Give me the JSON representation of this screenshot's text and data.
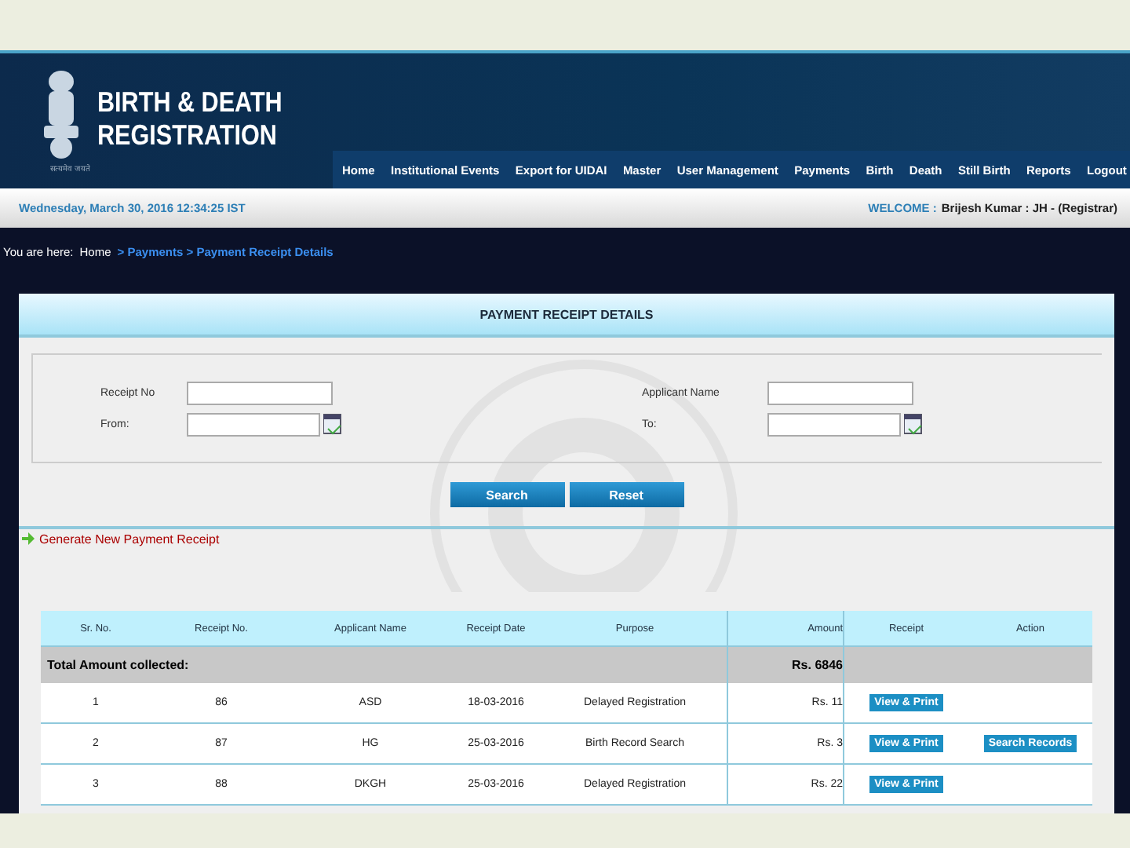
{
  "header": {
    "title_lines": [
      "BIRTH & DEATH",
      "REGISTRATION"
    ],
    "emblem_caption": "सत्यमेव जयते"
  },
  "nav": [
    "Home",
    "Institutional Events",
    "Export for UIDAI",
    "Master",
    "User Management",
    "Payments",
    "Birth",
    "Death",
    "Still Birth",
    "Reports",
    "Logout"
  ],
  "info_bar": {
    "datetime": "Wednesday, March 30, 2016 12:34:25 IST",
    "welcome_label": "WELCOME :",
    "user": "Brijesh Kumar : JH -  (Registrar)"
  },
  "breadcrumb": {
    "prefix": "You are here:",
    "home": "Home",
    "trail": "> Payments > Payment Receipt Details"
  },
  "panel": {
    "title": "PAYMENT RECEIPT DETAILS",
    "fields": [
      {
        "label": "Receipt No",
        "calendar": false
      },
      {
        "label": "Applicant Name",
        "calendar": false
      },
      {
        "label": "From:",
        "calendar": true
      },
      {
        "label": "To:",
        "calendar": true
      }
    ],
    "buttons": [
      "Search",
      "Reset"
    ],
    "generate_link": "Generate New Payment Receipt"
  },
  "table": {
    "columns": [
      "Sr. No.",
      "Receipt No.",
      "Applicant Name",
      "Receipt Date",
      "Purpose",
      "Amount",
      "Receipt",
      "Action"
    ],
    "total": {
      "label": "Total Amount collected:",
      "amount": "Rs. 6846"
    },
    "rows": [
      {
        "cells": [
          "1",
          "86",
          "ASD",
          "18-03-2016",
          "Delayed Registration",
          "Rs. 11"
        ],
        "receipt_button": "View & Print"
      },
      {
        "cells": [
          "2",
          "87",
          "HG",
          "25-03-2016",
          "Birth Record Search",
          "Rs. 3"
        ],
        "receipt_button": "View & Print",
        "action_button": "Search Records"
      },
      {
        "cells": [
          "3",
          "88",
          "DKGH",
          "25-03-2016",
          "Delayed Registration",
          "Rs. 22"
        ],
        "receipt_button": "View & Print"
      }
    ]
  }
}
